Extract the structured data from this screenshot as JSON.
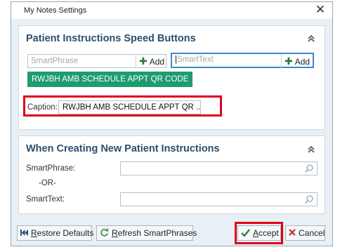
{
  "window": {
    "title": "My Notes Settings",
    "close_glyph": "✕"
  },
  "section1": {
    "title": "Patient Instructions Speed Buttons",
    "smartphrase_placeholder": "SmartPhrase",
    "smarttext_placeholder": "SmartText",
    "add_label": "Add",
    "chip_label": "RWJBH AMB SCHEDULE APPT QR CODE",
    "caption_label": "Caption:",
    "caption_value": "RWJBH AMB SCHEDULE APPT QR ..."
  },
  "section2": {
    "title": "When Creating New Patient Instructions",
    "smartphrase_label": "SmartPhrase:",
    "or_label": "-OR-",
    "smarttext_label": "SmartText:"
  },
  "footer": {
    "restore_prefix": "",
    "restore_underlined": "R",
    "restore_rest": "estore Defaults",
    "refresh_underlined": "R",
    "refresh_rest": "efresh SmartPhrases",
    "accept_underlined": "A",
    "accept_rest": "ccept",
    "cancel_label": "Cancel"
  },
  "colors": {
    "accent_green": "#1d9c70",
    "highlight_red": "#e0001a",
    "heading_blue": "#2a4f6e"
  },
  "icons": [
    "close-icon",
    "collapse-icon",
    "plus-icon",
    "search-icon",
    "restore-icon",
    "refresh-icon",
    "checkmark-icon",
    "x-icon"
  ]
}
